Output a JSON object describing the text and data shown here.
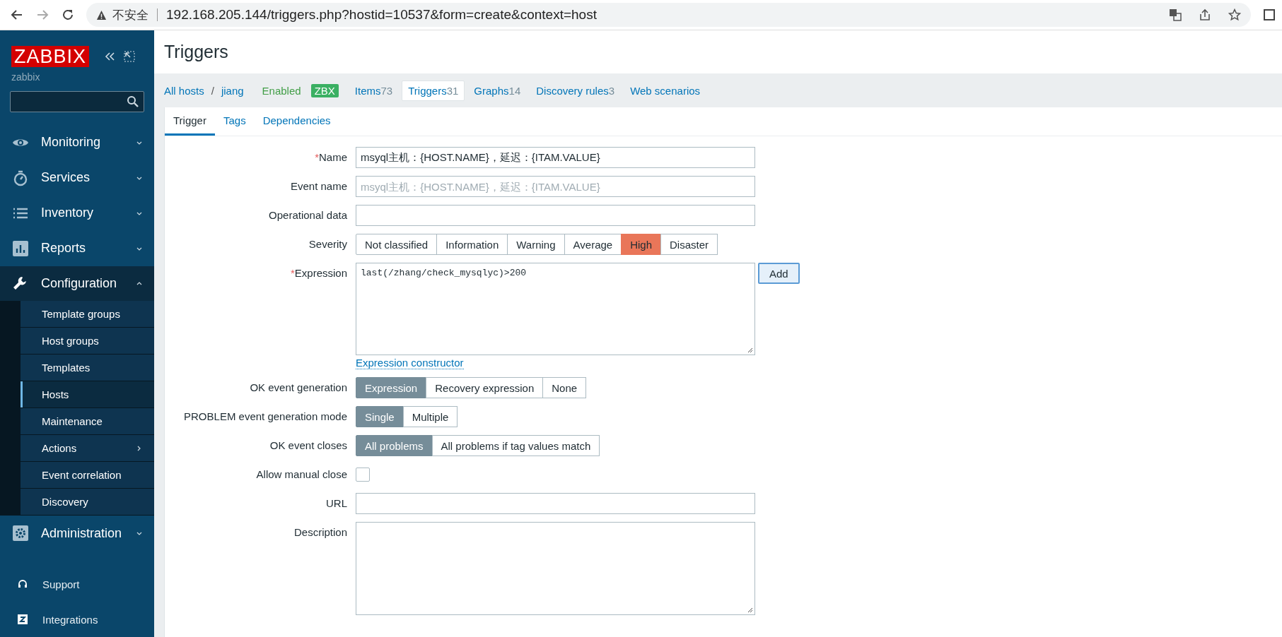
{
  "browser": {
    "security_label": "不安全",
    "url": "192.168.205.144/triggers.php?hostid=10537&form=create&context=host"
  },
  "sidebar": {
    "logo": "ZABBIX",
    "user": "zabbix",
    "menu": [
      {
        "label": "Monitoring",
        "expanded": false
      },
      {
        "label": "Services",
        "expanded": false
      },
      {
        "label": "Inventory",
        "expanded": false
      },
      {
        "label": "Reports",
        "expanded": false
      },
      {
        "label": "Configuration",
        "expanded": true,
        "children": [
          {
            "label": "Template groups",
            "selected": false,
            "submenu": false
          },
          {
            "label": "Host groups",
            "selected": false,
            "submenu": false
          },
          {
            "label": "Templates",
            "selected": false,
            "submenu": false
          },
          {
            "label": "Hosts",
            "selected": true,
            "submenu": false
          },
          {
            "label": "Maintenance",
            "selected": false,
            "submenu": false
          },
          {
            "label": "Actions",
            "selected": false,
            "submenu": true
          },
          {
            "label": "Event correlation",
            "selected": false,
            "submenu": false
          },
          {
            "label": "Discovery",
            "selected": false,
            "submenu": false
          }
        ]
      },
      {
        "label": "Administration",
        "expanded": false
      }
    ],
    "footer": [
      {
        "label": "Support"
      },
      {
        "label": "Integrations"
      }
    ]
  },
  "page_title": "Triggers",
  "host_nav": {
    "all_hosts": "All hosts",
    "separator": "/",
    "host": "jiang",
    "status": "Enabled",
    "badge": "ZBX",
    "tabs": [
      {
        "label": "Items",
        "count": "73",
        "selected": false
      },
      {
        "label": "Triggers",
        "count": "31",
        "selected": true
      },
      {
        "label": "Graphs",
        "count": "14",
        "selected": false
      },
      {
        "label": "Discovery rules",
        "count": "3",
        "selected": false
      },
      {
        "label": "Web scenarios",
        "selected": false
      }
    ]
  },
  "form_tabs": [
    {
      "label": "Trigger",
      "selected": true
    },
    {
      "label": "Tags",
      "selected": false
    },
    {
      "label": "Dependencies",
      "selected": false
    }
  ],
  "form": [
    {
      "kind": "text",
      "label": "Name",
      "asterisk": "*",
      "value": "msyql主机：{HOST.NAME}，延迟：{ITAM.VALUE}"
    },
    {
      "kind": "text",
      "label": "Event name",
      "placeholder": "msyql主机：{HOST.NAME}，延迟：{ITAM.VALUE}"
    },
    {
      "kind": "text",
      "label": "Operational data"
    },
    {
      "kind": "segmented",
      "label": "Severity",
      "options": [
        {
          "label": "Not classified",
          "selected": false
        },
        {
          "label": "Information",
          "selected": false
        },
        {
          "label": "Warning",
          "selected": false
        },
        {
          "label": "Average",
          "selected": false
        },
        {
          "label": "High",
          "selected": true,
          "color": "#e97659"
        },
        {
          "label": "Disaster",
          "selected": false
        }
      ]
    },
    {
      "kind": "expression",
      "label": "Expression",
      "asterisk": "*",
      "value": "last(/zhang/check_mysqlyc)>200",
      "button": "Add",
      "link": "Expression constructor"
    },
    {
      "kind": "segmented",
      "label": "OK event generation",
      "options": [
        {
          "label": "Expression",
          "selected": true
        },
        {
          "label": "Recovery expression",
          "selected": false
        },
        {
          "label": "None",
          "selected": false
        }
      ]
    },
    {
      "kind": "segmented",
      "label": "PROBLEM event generation mode",
      "options": [
        {
          "label": "Single",
          "selected": true
        },
        {
          "label": "Multiple",
          "selected": false
        }
      ]
    },
    {
      "kind": "segmented",
      "label": "OK event closes",
      "options": [
        {
          "label": "All problems",
          "selected": true
        },
        {
          "label": "All problems if tag values match",
          "selected": false
        }
      ]
    },
    {
      "kind": "checkbox",
      "label": "Allow manual close",
      "checked": false
    },
    {
      "kind": "text",
      "label": "URL"
    },
    {
      "kind": "textarea",
      "label": "Description"
    }
  ]
}
